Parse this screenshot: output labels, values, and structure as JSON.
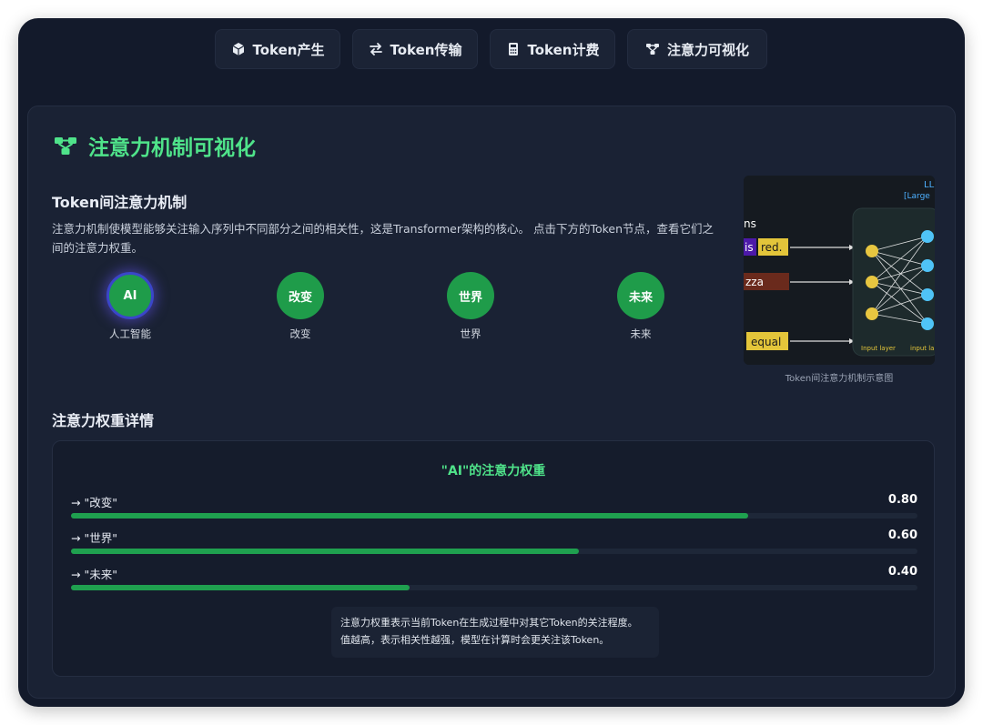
{
  "tabs": [
    {
      "label": "Token产生",
      "icon": "cube-icon"
    },
    {
      "label": "Token传输",
      "icon": "swap-arrows-icon"
    },
    {
      "label": "Token计费",
      "icon": "calculator-icon"
    },
    {
      "label": "注意力可视化",
      "icon": "network-icon"
    }
  ],
  "section": {
    "title": "注意力机制可视化",
    "subtitle": "Token间注意力机制",
    "description": "注意力机制使模型能够关注输入序列中不同部分之间的相关性，这是Transformer架构的核心。 点击下方的Token节点，查看它们之间的注意力权重。"
  },
  "nodes": [
    {
      "token": "AI",
      "label": "人工智能",
      "active": true
    },
    {
      "token": "改变",
      "label": "改变",
      "active": false
    },
    {
      "token": "世界",
      "label": "世界",
      "active": false
    },
    {
      "token": "未来",
      "label": "未来",
      "active": false
    }
  ],
  "diagram": {
    "caption": "Token间注意力机制示意图",
    "texts": {
      "top_right": "LL",
      "top_right_sub": "[Large",
      "left_cut": "ns",
      "chip_is": "is",
      "chip_red": "red.",
      "chip_zza": "zza",
      "chip_equal": "equal",
      "layer1": "Input layer",
      "layer2": "input la"
    }
  },
  "details": {
    "heading": "注意力权重详情",
    "title": "\"AI\"的注意力权重",
    "rows": [
      {
        "label": "→ \"改变\"",
        "value": "0.80",
        "weight": 0.8
      },
      {
        "label": "→ \"世界\"",
        "value": "0.60",
        "weight": 0.6
      },
      {
        "label": "→ \"未来\"",
        "value": "0.40",
        "weight": 0.4
      }
    ],
    "note_line1": "注意力权重表示当前Token在生成过程中对其它Token的关注程度。",
    "note_line2": "值越高，表示相关性越强，模型在计算时会更关注该Token。"
  },
  "colors": {
    "accent": "#4fe38a",
    "bar": "#1fa04f",
    "background": "#131a2b"
  }
}
